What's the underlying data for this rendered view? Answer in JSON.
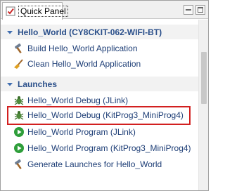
{
  "tab": {
    "label": "Quick Panel"
  },
  "sections": [
    {
      "title": "Hello_World (CY8CKIT-062-WIFI-BT)",
      "items": [
        {
          "label": "Build Hello_World Application",
          "icon": "hammer-icon"
        },
        {
          "label": "Clean Hello_World Application",
          "icon": "broom-icon"
        }
      ]
    },
    {
      "title": "Launches",
      "items": [
        {
          "label": "Hello_World Debug (JLink)",
          "icon": "bug-icon"
        },
        {
          "label": "Hello_World Debug (KitProg3_MiniProg4)",
          "icon": "bug-icon"
        },
        {
          "label": "Hello_World Program (JLink)",
          "icon": "run-icon"
        },
        {
          "label": "Hello_World Program (KitProg3_MiniProg4)",
          "icon": "run-icon"
        },
        {
          "label": "Generate Launches for Hello_World",
          "icon": "hammer-icon"
        }
      ]
    }
  ],
  "colors": {
    "section_title": "#2a4f8a",
    "item_text": "#1f3f77",
    "highlight_border": "#d21f1f",
    "run_icon": "#2e9e3a"
  }
}
